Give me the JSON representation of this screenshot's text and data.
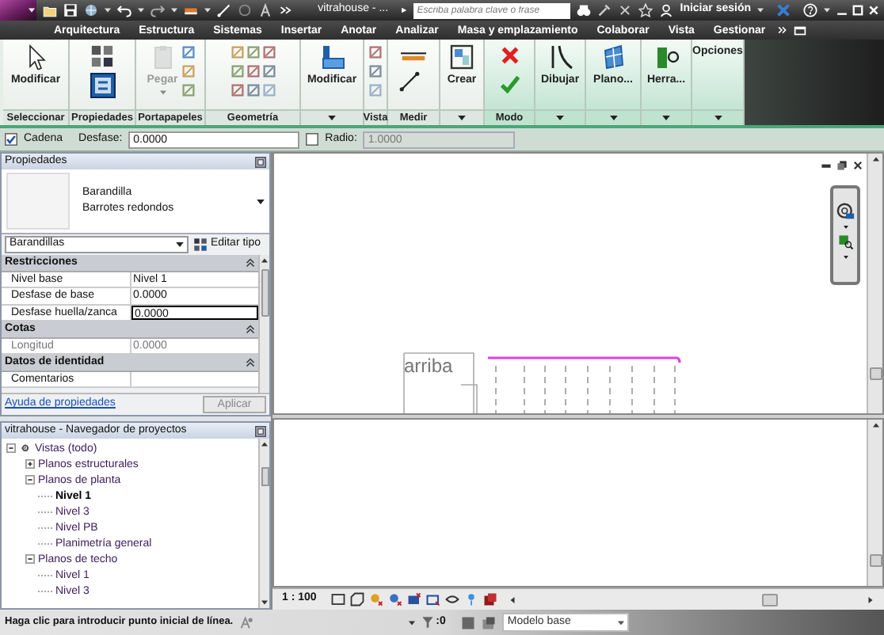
{
  "title_bar": {
    "title": "vitrahouse - ...",
    "search": {
      "placeholder": "Escriba palabra clave o frase"
    },
    "sign_in": "Iniciar sesión"
  },
  "tabs": [
    "Arquitectura",
    "Estructura",
    "Sistemas",
    "Insertar",
    "Anotar",
    "Analizar",
    "Masa y emplazamiento",
    "Colaborar",
    "Vista",
    "Gestionar"
  ],
  "ribbon": [
    {
      "label": "Seleccionar",
      "contextual": false,
      "button": {
        "label": "Modificar",
        "disabled": false
      }
    },
    {
      "label": "Propiedades",
      "contextual": false
    },
    {
      "label": "Portapapeles",
      "contextual": false,
      "button": {
        "label": "Pegar",
        "disabled": true
      }
    },
    {
      "label": "Geometría",
      "contextual": false
    },
    {
      "contextual": false,
      "button": {
        "label": "Modificar",
        "disabled": false
      }
    },
    {
      "label": "Vista",
      "contextual": false
    },
    {
      "label": "Medir",
      "contextual": false
    },
    {
      "contextual": false,
      "button": {
        "label": "Crear",
        "disabled": false
      }
    },
    {
      "label": "Modo",
      "contextual": true
    },
    {
      "contextual": true,
      "button": {
        "label": "Dibujar",
        "disabled": false
      }
    },
    {
      "contextual": true,
      "button": {
        "label": "Plano...",
        "disabled": false
      }
    },
    {
      "contextual": true,
      "button": {
        "label": "Herra...",
        "disabled": false
      }
    },
    {
      "contextual": true,
      "title": "Opciones"
    }
  ],
  "options_bar": {
    "chain": {
      "label": "Cadena",
      "checked": true
    },
    "offset": {
      "label": "Desfase:",
      "value": "0.0000"
    },
    "radius": {
      "label": "Radio:",
      "checked": false,
      "value": "1.0000",
      "disabled": true
    }
  },
  "properties": {
    "title": "Propiedades",
    "type": {
      "family": "Barandilla",
      "name": "Barrotes redondos"
    },
    "filter": "Barandillas",
    "edit_type": "Editar tipo",
    "groups": [
      {
        "name": "Restricciones",
        "expanded": true,
        "rows": [
          {
            "name": "Nivel base",
            "value": "Nivel 1",
            "editing": false,
            "read_only": false
          },
          {
            "name": "Desfase de base",
            "value": "0.0000",
            "editing": false,
            "read_only": false
          },
          {
            "name": "Desfase huella/zanca",
            "value": "0.0000",
            "editing": true,
            "read_only": false
          }
        ]
      },
      {
        "name": "Cotas",
        "expanded": true,
        "rows": [
          {
            "name": "Longitud",
            "value": "0.0000",
            "editing": false,
            "read_only": true
          }
        ]
      },
      {
        "name": "Datos de identidad",
        "expanded": true,
        "rows": [
          {
            "name": "Comentarios",
            "editing": false,
            "read_only": false
          }
        ]
      }
    ],
    "help_link": "Ayuda de propiedades",
    "apply": {
      "label": "Aplicar",
      "disabled": true
    }
  },
  "project_browser": {
    "title": "vitrahouse - Navegador de proyectos",
    "tree": [
      {
        "label": "Vistas (todo)",
        "expanded": true,
        "selected": false,
        "children": [
          {
            "label": "Planos estructurales",
            "expanded": false,
            "selected": false
          },
          {
            "label": "Planos de planta",
            "expanded": true,
            "selected": false,
            "children": [
              {
                "label": "Nivel 1",
                "selected": true
              },
              {
                "label": "Nivel 3",
                "selected": false
              },
              {
                "label": "Nivel PB",
                "selected": false
              },
              {
                "label": "Planimetría general",
                "selected": false
              }
            ]
          },
          {
            "label": "Planos de techo",
            "expanded": true,
            "selected": false,
            "children": [
              {
                "label": "Nivel 1",
                "selected": false
              },
              {
                "label": "Nivel 3",
                "selected": false
              }
            ]
          }
        ]
      }
    ]
  },
  "view": {
    "annotation": "arriba",
    "scale": "1 : 100"
  },
  "status_bar": {
    "message": "Haga clic para introducir punto inicial de línea.",
    "worksets": ":0",
    "model": "Modelo base"
  }
}
